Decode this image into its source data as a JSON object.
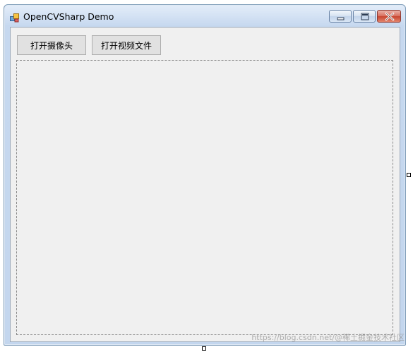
{
  "window": {
    "title": "OpenCVSharp Demo"
  },
  "buttons": {
    "open_camera": "打开摄像头",
    "open_video_file": "打开视频文件"
  },
  "icons": {
    "app": "winforms-app-icon",
    "minimize": "minimize-icon",
    "maximize": "maximize-icon",
    "close": "close-icon"
  },
  "watermark": {
    "text": "https://blog.csdn.net/@稀土掘金技术社区"
  },
  "colors": {
    "client_background": "#f0f0f0",
    "button_background": "#e1e1e1",
    "button_border": "#adadad",
    "close_button": "#c7442f",
    "title_bar": "#c6d8ef"
  }
}
